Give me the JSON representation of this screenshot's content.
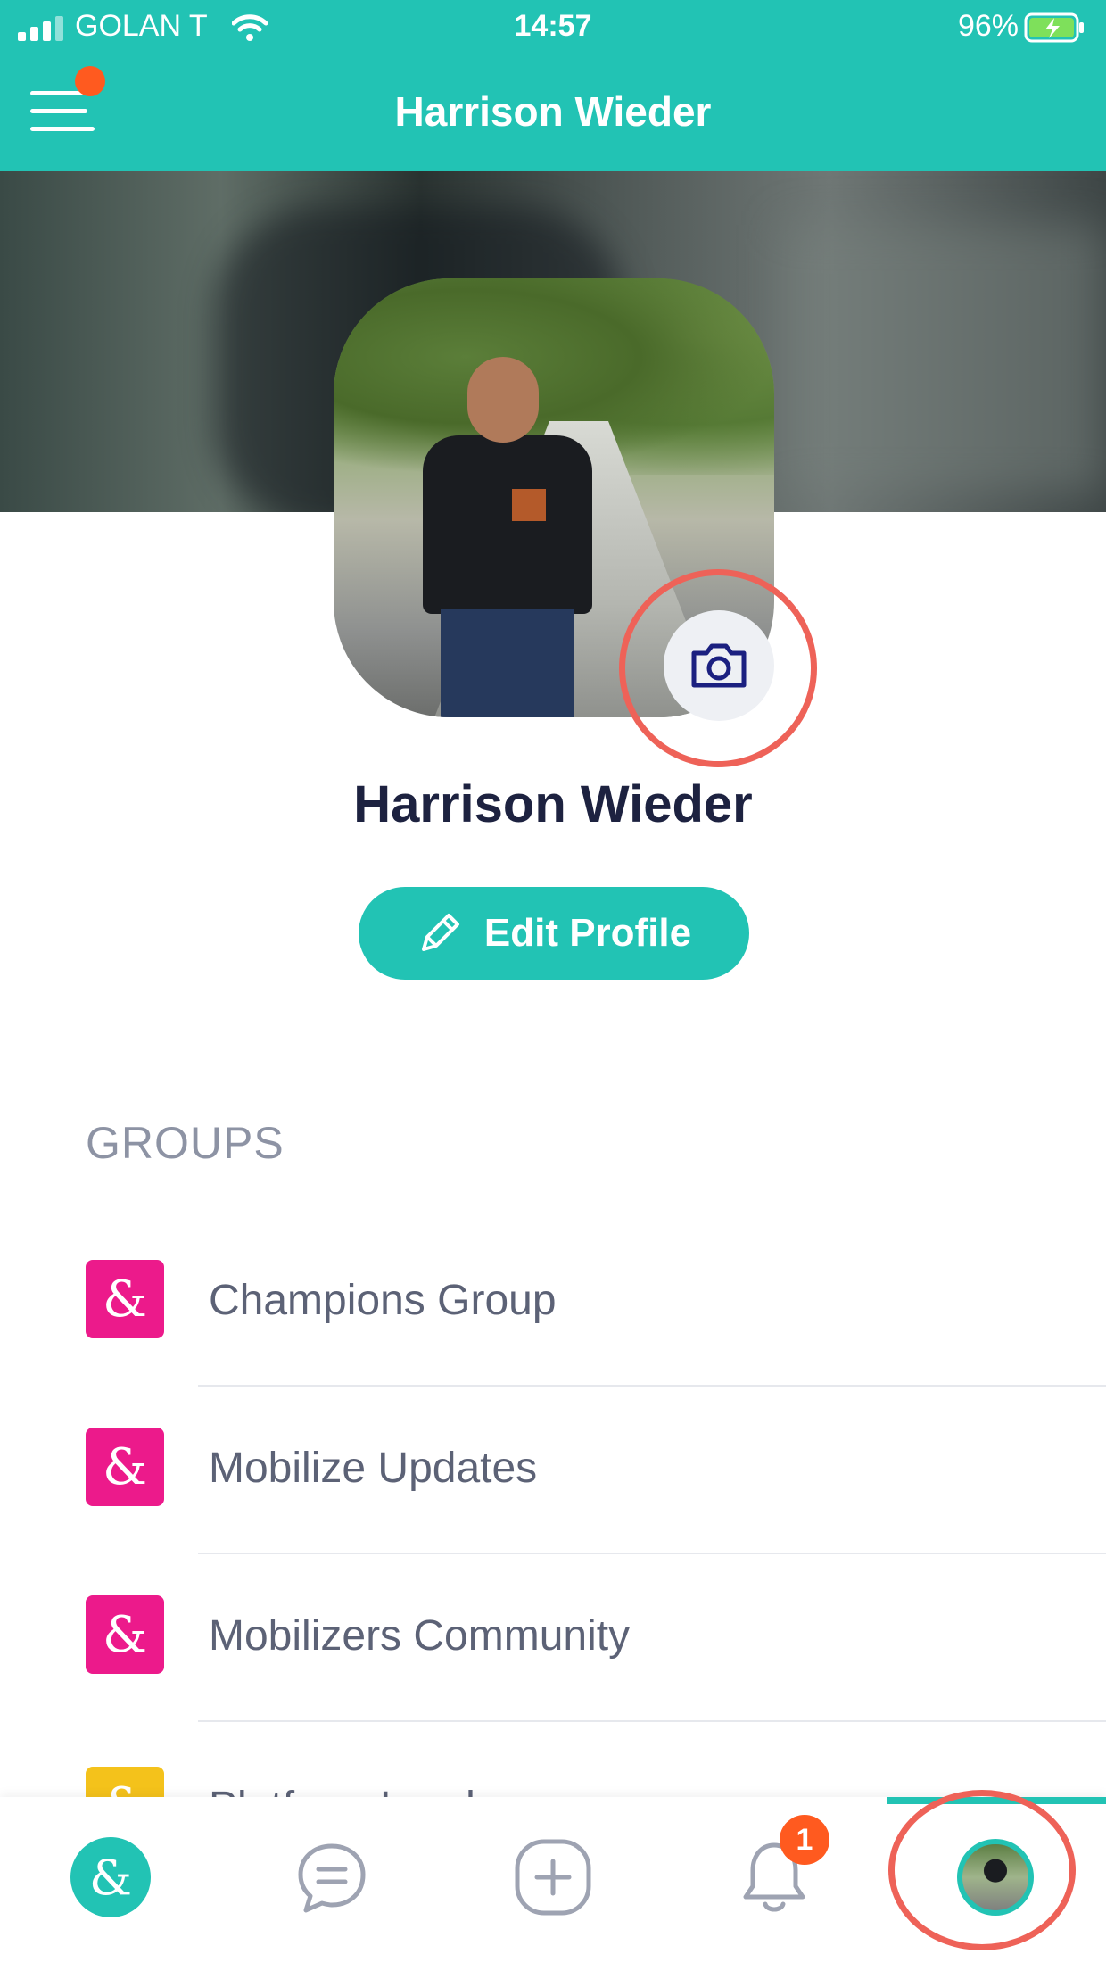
{
  "status_bar": {
    "carrier": "GOLAN T",
    "time": "14:57",
    "battery_percent": "96%"
  },
  "header": {
    "title": "Harrison Wieder",
    "menu_has_notification": true
  },
  "profile": {
    "name": "Harrison Wieder",
    "edit_button_label": "Edit Profile"
  },
  "groups": {
    "title": "GROUPS",
    "items": [
      {
        "label": "Champions Group",
        "icon_color": "#ec1a8b"
      },
      {
        "label": "Mobilize Updates",
        "icon_color": "#ec1a8b"
      },
      {
        "label": "Mobilizers Community",
        "icon_color": "#ec1a8b"
      },
      {
        "label": "Platform Leads",
        "icon_color": "#f4c21b"
      }
    ]
  },
  "bottom_nav": {
    "items": [
      "home-icon",
      "chat-icon",
      "add-icon",
      "bell-icon",
      "profile-avatar"
    ],
    "notification_count": "1"
  },
  "colors": {
    "brand": "#22c3b4",
    "accent": "#ff5a1f",
    "highlight_ring": "#ee6258"
  }
}
